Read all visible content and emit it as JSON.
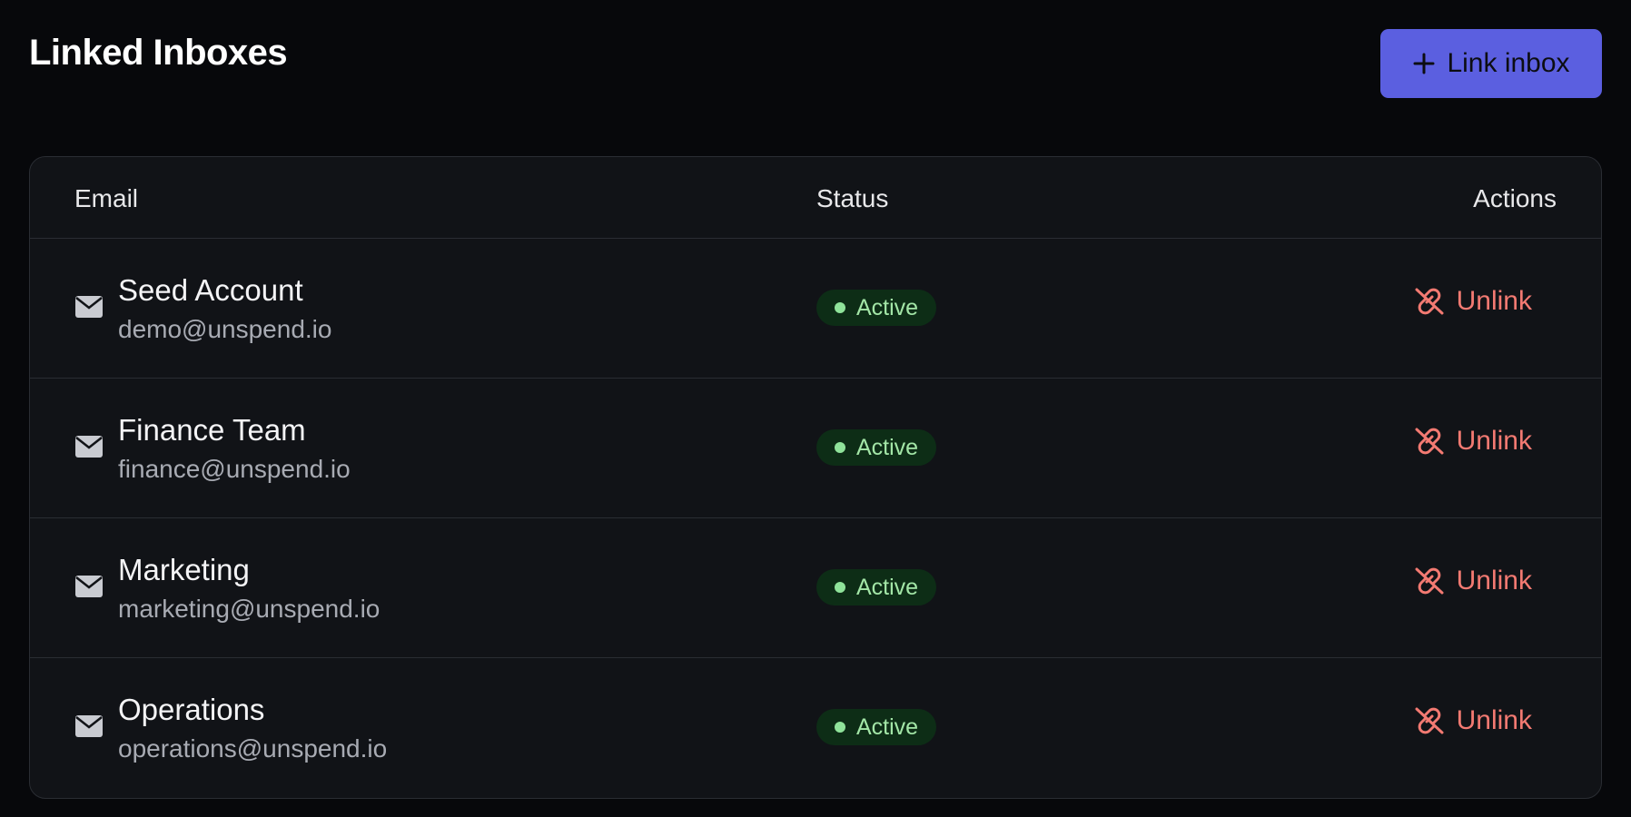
{
  "header": {
    "title": "Linked Inboxes",
    "link_button_label": "Link inbox",
    "link_button_icon": "plus-icon",
    "accent_color": "#5b5fe0"
  },
  "table": {
    "columns": [
      "Email",
      "Status",
      "Actions"
    ],
    "rows": [
      {
        "name": "Seed Account",
        "email": "demo@unspend.io",
        "status": "Active",
        "action": "Unlink"
      },
      {
        "name": "Finance Team",
        "email": "finance@unspend.io",
        "status": "Active",
        "action": "Unlink"
      },
      {
        "name": "Marketing",
        "email": "marketing@unspend.io",
        "status": "Active",
        "action": "Unlink"
      },
      {
        "name": "Operations",
        "email": "operations@unspend.io",
        "status": "Active",
        "action": "Unlink"
      }
    ],
    "row_icon": "envelope-icon",
    "action_icon": "unlink-icon",
    "status_color": "#8fe39a",
    "action_color": "#f37a72"
  }
}
